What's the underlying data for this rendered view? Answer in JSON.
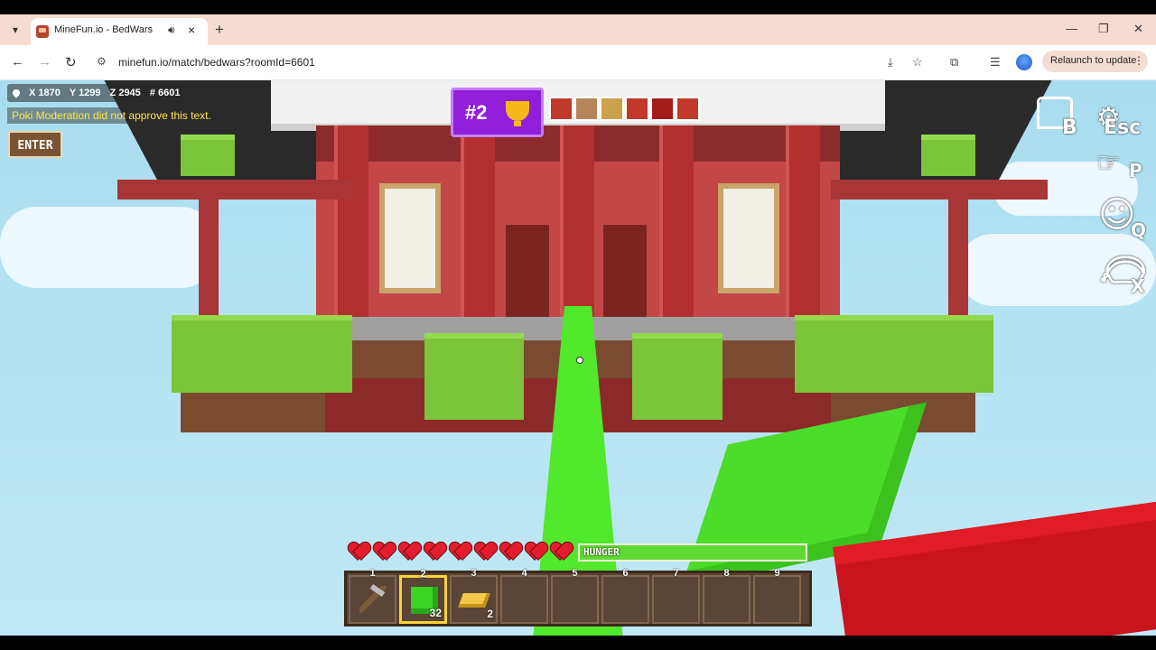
{
  "browser": {
    "tab_title": "MineFun.io - BedWars",
    "url": "minefun.io/match/bedwars?roomId=6601",
    "relaunch_label": "Relaunch to update"
  },
  "hud": {
    "coords": {
      "x": "X 1870",
      "y": "Y 1299",
      "z": "Z 2945",
      "room": "# 6601"
    },
    "moderation_message": "Poki Moderation did not approve this text.",
    "enter_label": "ENTER",
    "rank": "#2",
    "players": [
      {
        "color": "#c0392b"
      },
      {
        "color": "#b8845a"
      },
      {
        "color": "#c9a24a"
      },
      {
        "color": "#c0392b"
      },
      {
        "color": "#a31c1c"
      },
      {
        "color": "#c0392b"
      }
    ],
    "right_icons": {
      "shop_key": "B",
      "esc_key": "Esc",
      "p_key": "P",
      "q_key": "Q",
      "x_key": "X"
    },
    "hearts": 9,
    "hunger_label": "HUNGER",
    "hunger_level": 1.0
  },
  "hotbar": {
    "selected": 2,
    "slots": [
      {
        "num": "1",
        "item": "pickaxe",
        "count": ""
      },
      {
        "num": "2",
        "item": "green-block",
        "count": "32"
      },
      {
        "num": "3",
        "item": "gold-ingot",
        "count": "2"
      },
      {
        "num": "4",
        "item": "",
        "count": ""
      },
      {
        "num": "5",
        "item": "",
        "count": ""
      },
      {
        "num": "6",
        "item": "",
        "count": ""
      },
      {
        "num": "7",
        "item": "",
        "count": ""
      },
      {
        "num": "8",
        "item": "",
        "count": ""
      },
      {
        "num": "9",
        "item": "",
        "count": ""
      }
    ]
  }
}
